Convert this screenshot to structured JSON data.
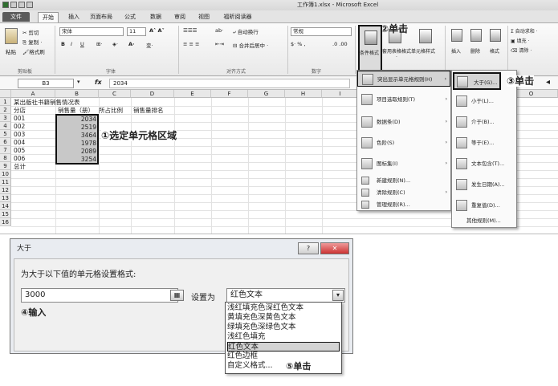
{
  "excel": {
    "window_title": "工作簿1.xlsx - Microsoft Excel",
    "tabs": [
      "文件",
      "开始",
      "插入",
      "页面布局",
      "公式",
      "数据",
      "审阅",
      "视图",
      "福昕阅读器"
    ],
    "ribbon": {
      "clipboard": {
        "paste": "粘贴",
        "cut": "剪切",
        "copy": "复制 ·",
        "format_painter": "格式刷",
        "group": "剪贴板"
      },
      "font": {
        "name": "宋体",
        "size": "11",
        "bold": "B",
        "italic": "I",
        "underline": "U",
        "group": "字体"
      },
      "alignment": {
        "wrap": "自动换行",
        "merge": "合并后居中 ·",
        "group": "对齐方式"
      },
      "number": {
        "format": "常规",
        "pct": "% ,",
        "group": "数字"
      },
      "styles": {
        "conditional": "条件格式",
        "table": "套用表格格式 ·",
        "cell_styles": "单元格样式"
      },
      "cells": {
        "insert": "插入",
        "delete": "删除",
        "format": "格式"
      },
      "editing": {
        "autosum": "Σ 自动求和 ·",
        "fill": "填充 ·",
        "clear": "清除 ·"
      }
    },
    "formula_bar": {
      "name_box": "B3",
      "fx": "fx",
      "value": "2034"
    },
    "columns": [
      "A",
      "B",
      "C",
      "D",
      "E",
      "F",
      "G",
      "H",
      "I",
      "",
      "",
      "",
      "",
      "",
      "O"
    ],
    "rows": [
      "1",
      "2",
      "3",
      "4",
      "5",
      "6",
      "7",
      "8",
      "9",
      "10",
      "11",
      "12",
      "13",
      "14",
      "15",
      "16"
    ],
    "cells": {
      "a1": "某出版社书籍销售情况表",
      "a2": "分店",
      "b2": "销售量（册）",
      "c2": "所占比例",
      "d2": "销售量排名",
      "stores": [
        "001",
        "002",
        "003",
        "004",
        "005",
        "006"
      ],
      "sales": [
        "2034",
        "2519",
        "3464",
        "1978",
        "2089",
        "3254"
      ],
      "a9": "总计"
    },
    "cf_menu": [
      {
        "label": "突出显示单元格规则(H)",
        "arrow": "›"
      },
      {
        "label": "项目选取规则(T)",
        "arrow": "›"
      },
      {
        "label": "数据条(D)",
        "arrow": "›"
      },
      {
        "label": "色阶(S)",
        "arrow": "›"
      },
      {
        "label": "图标集(I)",
        "arrow": "›"
      },
      {
        "label": "新建规则(N)...",
        "arrow": ""
      },
      {
        "label": "清除规则(C)",
        "arrow": "›"
      },
      {
        "label": "管理规则(R)...",
        "arrow": ""
      }
    ],
    "sub_menu": [
      "大于(G)...",
      "小于(L)...",
      "介于(B)...",
      "等于(E)...",
      "文本包含(T)...",
      "发生日期(A)...",
      "重复值(D)...",
      "其他规则(M)..."
    ]
  },
  "dialog": {
    "title": "大于",
    "help": "?",
    "close": "✕",
    "prompt": "为大于以下值的单元格设置格式:",
    "value": "3000",
    "set_as": "设置为",
    "selected": "红色文本",
    "options": [
      "浅红填充色深红色文本",
      "黄填充色深黄色文本",
      "绿填充色深绿色文本",
      "浅红色填充",
      "红色文本",
      "红色边框",
      "自定义格式..."
    ]
  },
  "callouts": {
    "c1": "①选定单元格区域",
    "c2": "②单击",
    "c3": "③单击",
    "c4": "④输入",
    "c5": "⑤单击"
  },
  "colors": {
    "selection": "#c8c8c8",
    "menu_highlight": "#d4d4d4",
    "ribbon": "#ededed"
  }
}
